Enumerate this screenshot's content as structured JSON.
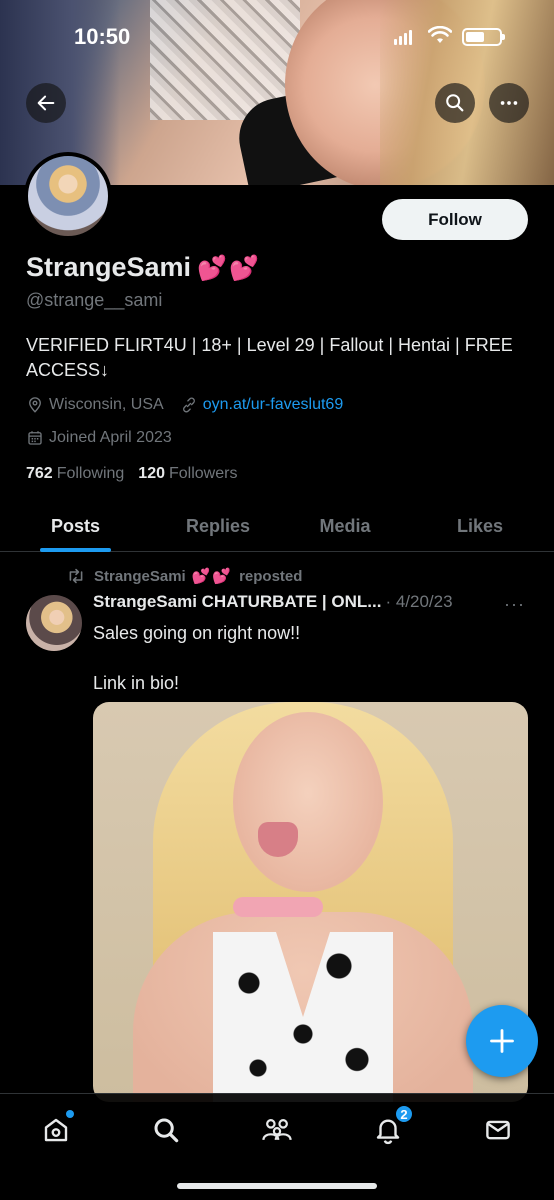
{
  "status_bar": {
    "time": "10:50"
  },
  "profile": {
    "display_name": "StrangeSami",
    "name_emoji": "💕💕",
    "handle": "@strange__sami",
    "follow_label": "Follow",
    "bio": "VERIFIED FLIRT4U | 18+ | Level 29 | Fallout | Hentai | FREE ACCESS↓",
    "location": "Wisconsin, USA",
    "link": "oyn.at/ur-faveslut69",
    "joined": "Joined April 2023",
    "following_count": "762",
    "following_label": "Following",
    "followers_count": "120",
    "followers_label": "Followers"
  },
  "tabs": [
    {
      "label": "Posts",
      "active": true
    },
    {
      "label": "Replies",
      "active": false
    },
    {
      "label": "Media",
      "active": false
    },
    {
      "label": "Likes",
      "active": false
    }
  ],
  "post": {
    "repost_by": "StrangeSami",
    "repost_emoji": "💕💕",
    "repost_label": "reposted",
    "author": "StrangeSami CHATURBATE | ONL...",
    "date": "· 4/20/23",
    "more": "···",
    "text": "Sales going on right now!!\n\nLink in bio!"
  },
  "nav": {
    "notifications_badge": "2"
  },
  "colors": {
    "accent": "#1d9bf0",
    "muted": "#71767b",
    "text": "#e7e9ea",
    "background": "#000000"
  }
}
